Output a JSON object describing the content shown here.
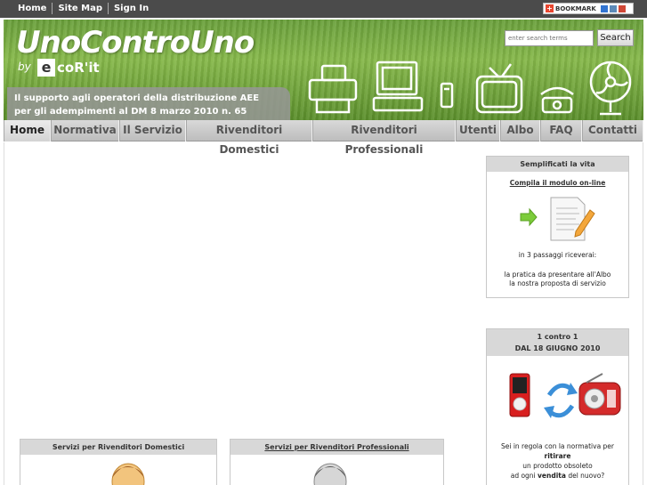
{
  "topbar": {
    "links": [
      "Home",
      "Site Map",
      "Sign In"
    ],
    "bookmark_label": "BOOKMARK"
  },
  "header": {
    "logo": "UnoControUno",
    "by_label": "by",
    "ecorit_letter": "e",
    "ecorit_text": "coR'it",
    "slogan_line1": "Il supporto agli operatori della distribuzione AEE",
    "slogan_line2": "per gli adempimenti al DM 8 marzo 2010 n. 65",
    "search_placeholder": "enter search terms",
    "search_button": "Search"
  },
  "nav": {
    "items": [
      "Home",
      "Normativa",
      "Il Servizio",
      "Rivenditori Domestici",
      "Rivenditori Professionali",
      "Utenti",
      "Albo",
      "FAQ",
      "Contatti"
    ],
    "active": "Home"
  },
  "sidebar": {
    "box1": {
      "title": "Semplificati la vita",
      "link": "Compila il modulo on-line",
      "text1": "in 3 passaggi riceverai:",
      "text2": "la pratica da presentare all'Albo",
      "text3": "la nostra proposta di servizio"
    },
    "box2": {
      "title_line1": "1 contro 1",
      "title_line2": "DAL 18 GIUGNO 2010",
      "text_line1_a": "Sei in regola con la normativa per ",
      "text_line1_b": "ritirare",
      "text_line2": "un prodotto obsoleto",
      "text_line3_a": "ad ogni ",
      "text_line3_b": "vendita",
      "text_line3_c": " del nuovo?"
    }
  },
  "main": {
    "card1_title": "Servizi per Rivenditori Domestici",
    "card2_title": "Servizi per Rivenditori Professionali"
  },
  "colors": {
    "topbar": "#4b4b4b",
    "nav": "#cfcfcf",
    "grass": "#6aa03c",
    "box_header": "#d8d8d8"
  }
}
